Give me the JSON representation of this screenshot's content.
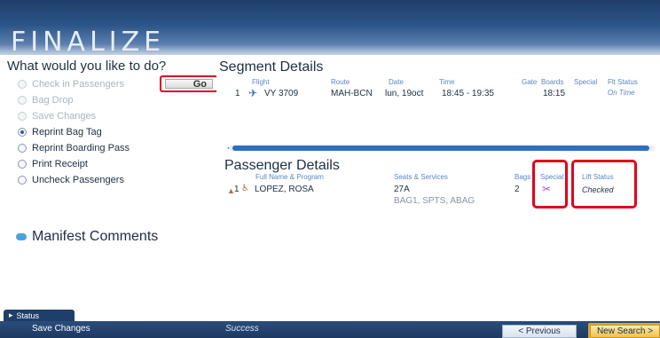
{
  "header": {
    "title": "FINALIZE"
  },
  "left": {
    "title": "What would you like to do?",
    "go_label": "Go",
    "options": [
      {
        "label": "Check in Passengers",
        "state": "disabled"
      },
      {
        "label": "Bag Drop",
        "state": "disabled"
      },
      {
        "label": "Save Changes",
        "state": "disabled"
      },
      {
        "label": "Reprint Bag Tag",
        "state": "selected"
      },
      {
        "label": "Reprint Boarding Pass",
        "state": "enabled"
      },
      {
        "label": "Print Receipt",
        "state": "enabled"
      },
      {
        "label": "Uncheck Passengers",
        "state": "enabled"
      }
    ]
  },
  "segment": {
    "title": "Segment Details",
    "headers": {
      "flight": "Flight",
      "route": "Route",
      "date": "Date",
      "time": "Time",
      "gate": "Gate",
      "boards": "Boards",
      "special": "Special",
      "flt_status": "Flt Status"
    },
    "row": {
      "index": "1",
      "flight": "VY 3709",
      "route": "MAH-BCN",
      "date": "lun, 19oct",
      "time": "18:45 - 19:35",
      "boards": "18:15",
      "status": "On Time"
    }
  },
  "passenger": {
    "title": "Passenger Details",
    "headers": {
      "name": "Full Name & Program",
      "seats": "Seats & Services",
      "bags": "Bags",
      "special": "Special",
      "lift": "Lift Status"
    },
    "row": {
      "index": "1",
      "name": "LOPEZ, ROSA",
      "seat": "27A",
      "services": "BAG1, SPTS, ABAG",
      "bags": "2",
      "lift": "Checked"
    }
  },
  "manifest": {
    "title": "Manifest Comments"
  },
  "bottom": {
    "status_tab": "Status",
    "save_changes": "Save Changes",
    "success": "Success",
    "previous": "< Previous",
    "new_search": "New Search >"
  },
  "colors": {
    "accent": "#2f6fc0",
    "highlight": "#e0001b",
    "banner": "#1e3f6a"
  },
  "icons": {
    "plane": "plane-icon",
    "special": "special-service-icon",
    "person": "person-icon",
    "manifest": "comment-icon"
  }
}
